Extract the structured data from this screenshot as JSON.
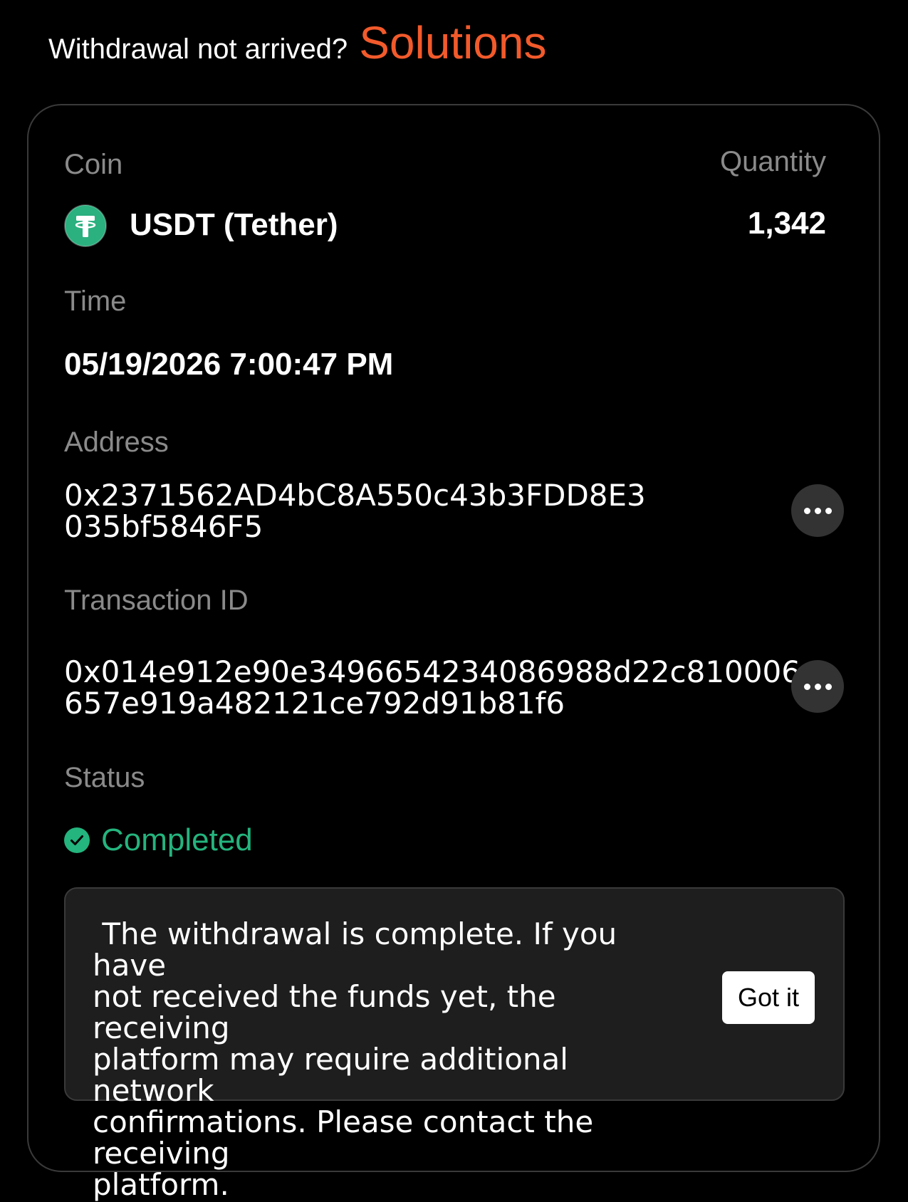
{
  "header": {
    "question": "Withdrawal not arrived?",
    "link_label": "Solutions",
    "link_color": "#f25a2b"
  },
  "coin": {
    "label": "Coin",
    "name": "USDT (Tether)",
    "icon": "tether-icon",
    "icon_color": "#2bb07f"
  },
  "quantity": {
    "label": "Quantity",
    "value": "1,342"
  },
  "time": {
    "label": "Time",
    "value": "05/19/2026 7:00:47 PM"
  },
  "address": {
    "label": "Address",
    "line1": "0x2371562AD4bC8A550c43b3FDD8E3",
    "line2": "035bf5846F5",
    "more_icon": "more-dots-icon"
  },
  "transaction": {
    "label": "Transaction ID",
    "line1": "0x014e912e90e349665423408698​8d22c810006",
    "line2": "657e919a482121ce792d91b81f6",
    "more_icon": "more-dots-icon"
  },
  "status": {
    "label": "Status",
    "value": "Completed",
    "icon": "check-circle-icon",
    "color": "#24b47e"
  },
  "notice": {
    "text": " The withdrawal is complete. If you have\nnot received the funds yet, the receiving\nplatform may require additional network\nconfirmations. Please contact the receiving\nplatform.",
    "button_label": "Got it"
  }
}
